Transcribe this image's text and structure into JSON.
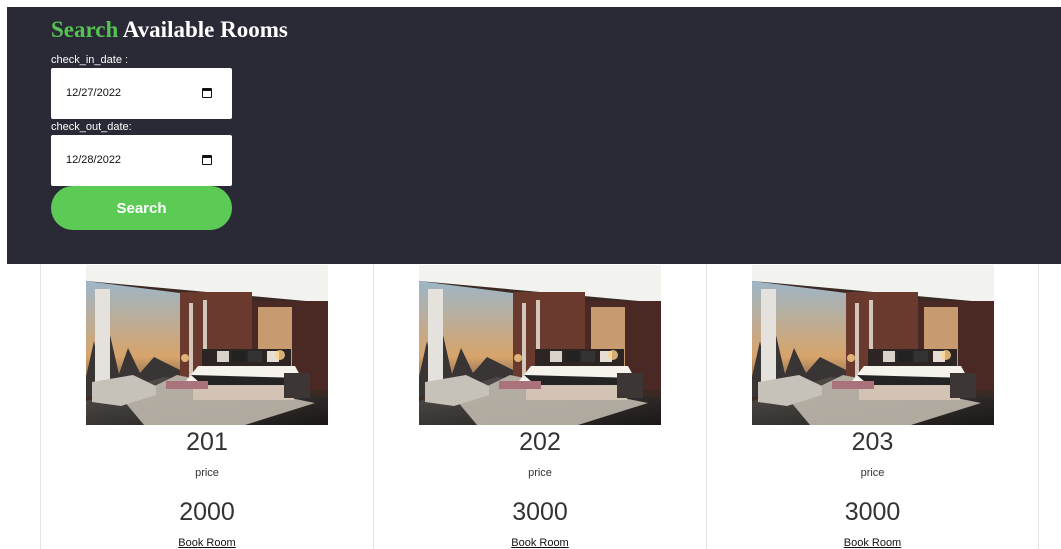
{
  "search": {
    "title_accent": "Search",
    "title_rest": " Available Rooms",
    "check_in_label": "check_in_date :",
    "check_in_value": "12/27/2022",
    "check_out_label": "check_out_date:",
    "check_out_value": "12/28/2022",
    "button_label": "Search",
    "accent_color": "#55c254",
    "panel_color": "#292a35"
  },
  "rooms": [
    {
      "number": "201",
      "price_label": "price",
      "price": "2000",
      "action": "Book Room"
    },
    {
      "number": "202",
      "price_label": "price",
      "price": "3000",
      "action": "Book Room"
    },
    {
      "number": "203",
      "price_label": "price",
      "price": "3000",
      "action": "Book Room"
    }
  ]
}
